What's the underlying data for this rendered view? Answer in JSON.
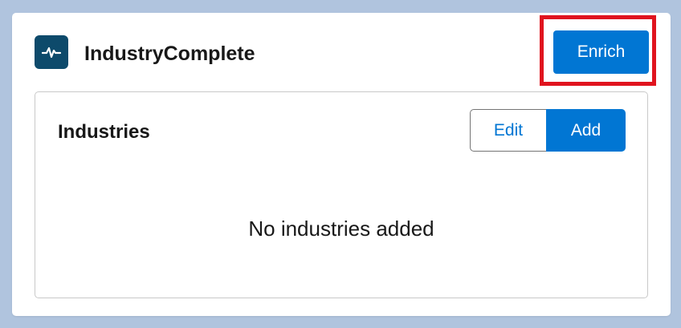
{
  "header": {
    "app_icon": "pulse-icon",
    "title": "IndustryComplete",
    "enrich_label": "Enrich"
  },
  "industries": {
    "title": "Industries",
    "edit_label": "Edit",
    "add_label": "Add",
    "empty_message": "No industries added"
  },
  "colors": {
    "page_background": "#b0c4de",
    "brand_blue": "#0176d3",
    "icon_background": "#0d4a6b",
    "highlight_red": "#e0141e"
  }
}
